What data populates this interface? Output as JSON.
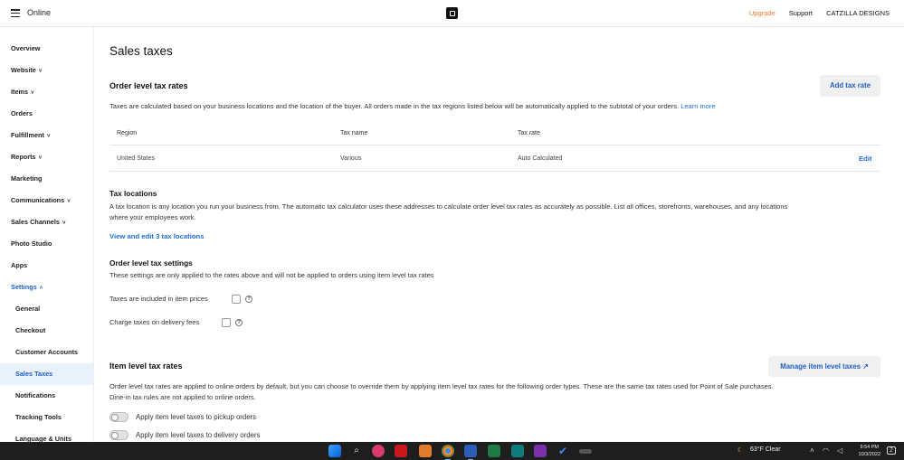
{
  "topbar": {
    "app_name": "Online",
    "upgrade": "Upgrade",
    "support": "Support",
    "account": "CATZILLA DESIGNS"
  },
  "sidebar": {
    "items": [
      {
        "label": "Overview",
        "chevron": ""
      },
      {
        "label": "Website",
        "chevron": "˅"
      },
      {
        "label": "Items",
        "chevron": "˅"
      },
      {
        "label": "Orders",
        "chevron": ""
      },
      {
        "label": "Fulfillment",
        "chevron": "˅"
      },
      {
        "label": "Reports",
        "chevron": "˅"
      },
      {
        "label": "Marketing",
        "chevron": ""
      },
      {
        "label": "Communications",
        "chevron": "˅"
      },
      {
        "label": "Sales Channels",
        "chevron": "˅"
      },
      {
        "label": "Photo Studio",
        "chevron": ""
      },
      {
        "label": "Apps",
        "chevron": ""
      },
      {
        "label": "Settings",
        "chevron": "˄"
      }
    ],
    "sub_items": [
      {
        "label": "General"
      },
      {
        "label": "Checkout"
      },
      {
        "label": "Customer Accounts"
      },
      {
        "label": "Sales Taxes"
      },
      {
        "label": "Notifications"
      },
      {
        "label": "Tracking Tools"
      },
      {
        "label": "Language & Units"
      }
    ]
  },
  "main": {
    "page_title": "Sales taxes",
    "order_level": {
      "title": "Order level tax rates",
      "add_button": "Add tax rate",
      "description": "Taxes are calculated based on your business locations and the location of the buyer. All orders made in the tax regions listed below will be automatically applied to the subtotal of your orders.",
      "learn_more": "Learn more",
      "table": {
        "headers": [
          "Region",
          "Tax name",
          "Tax rate"
        ],
        "rows": [
          {
            "region": "United States",
            "tax_name": "Various",
            "tax_rate": "Auto Calculated",
            "action": "Edit"
          }
        ]
      }
    },
    "tax_locations": {
      "title": "Tax locations",
      "description_line1": "A tax location is any location you run your business from. The automatic tax calculator uses these addresses to calculate order level tax rates as accurately as possible. List all offices, storefronts, warehouses, and any locations",
      "description_line2": "where your employees work.",
      "link": "View and edit 3 tax locations"
    },
    "order_settings": {
      "title": "Order level tax settings",
      "description": "These settings are only applied to the rates above and will not be applied to orders using item level tax rates",
      "option1": "Taxes are included in item prices",
      "option2": "Charge taxes on delivery fees"
    },
    "item_level": {
      "title": "Item level tax rates",
      "manage_button": "Manage item level taxes",
      "description_line1": "Order level tax rates are applied to online orders by default, but you can choose to override them by applying item level tax rates for the following order types. These are the same tax rates used for Point of Sale purchases.",
      "description_line2": "Dine-in tax rules are not applied to online orders.",
      "toggle1": "Apply item level taxes to pickup orders",
      "toggle2": "Apply item level taxes to delivery orders"
    }
  },
  "taskbar": {
    "weather": "63°F  Clear",
    "time": "9:54 PM",
    "date": "10/3/2022",
    "notification_count": "2"
  }
}
